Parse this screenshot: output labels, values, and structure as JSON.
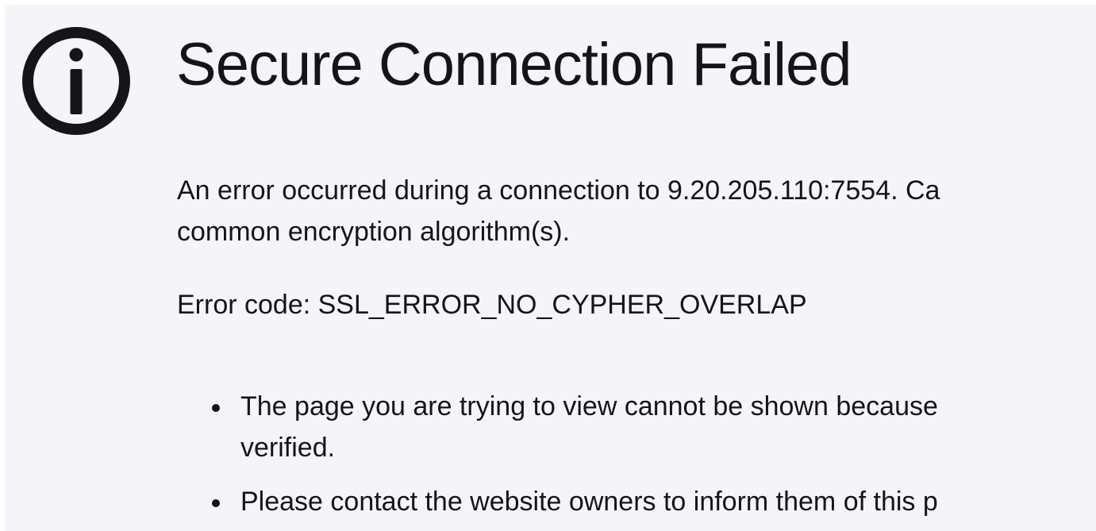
{
  "error_page": {
    "icon": "info-icon",
    "title": "Secure Connection Failed",
    "description_line1": "An error occurred during a connection to 9.20.205.110:7554. Ca",
    "description_line2": "common encryption algorithm(s).",
    "error_code": "Error code: SSL_ERROR_NO_CYPHER_OVERLAP",
    "reasons": [
      {
        "line1": "The page you are trying to view cannot be shown because",
        "line2": "verified."
      },
      {
        "line1": "Please contact the website owners to inform them of this p"
      }
    ]
  }
}
